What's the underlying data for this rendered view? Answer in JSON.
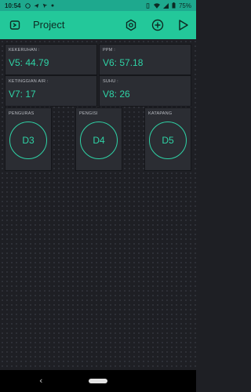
{
  "status_bar": {
    "time": "10:54",
    "battery": "75%"
  },
  "app_bar": {
    "title": "Project"
  },
  "widgets": [
    {
      "label": "KEKERUHAN :",
      "value": "V5: 44.79"
    },
    {
      "label": "PPM :",
      "value": "V6: 57.18"
    },
    {
      "label": "KETINGGIAN AIR :",
      "value": "V7: 17"
    },
    {
      "label": "SUHU :",
      "value": "V8: 26"
    }
  ],
  "buttons": [
    {
      "label": "PENGURAS",
      "pin": "D3"
    },
    {
      "label": "PENGISI",
      "pin": "D4"
    },
    {
      "label": "KATAPANG",
      "pin": "D5"
    }
  ],
  "colors": {
    "accent": "#23c89a",
    "value_text": "#2fd3a6",
    "widget_bg": "#2b2d33",
    "canvas_bg": "#1e1f24"
  },
  "icons": {
    "app_bar_left": "device-switch-icon",
    "settings": "hexagon-settings-icon",
    "add": "plus-circle-icon",
    "run": "play-icon"
  }
}
